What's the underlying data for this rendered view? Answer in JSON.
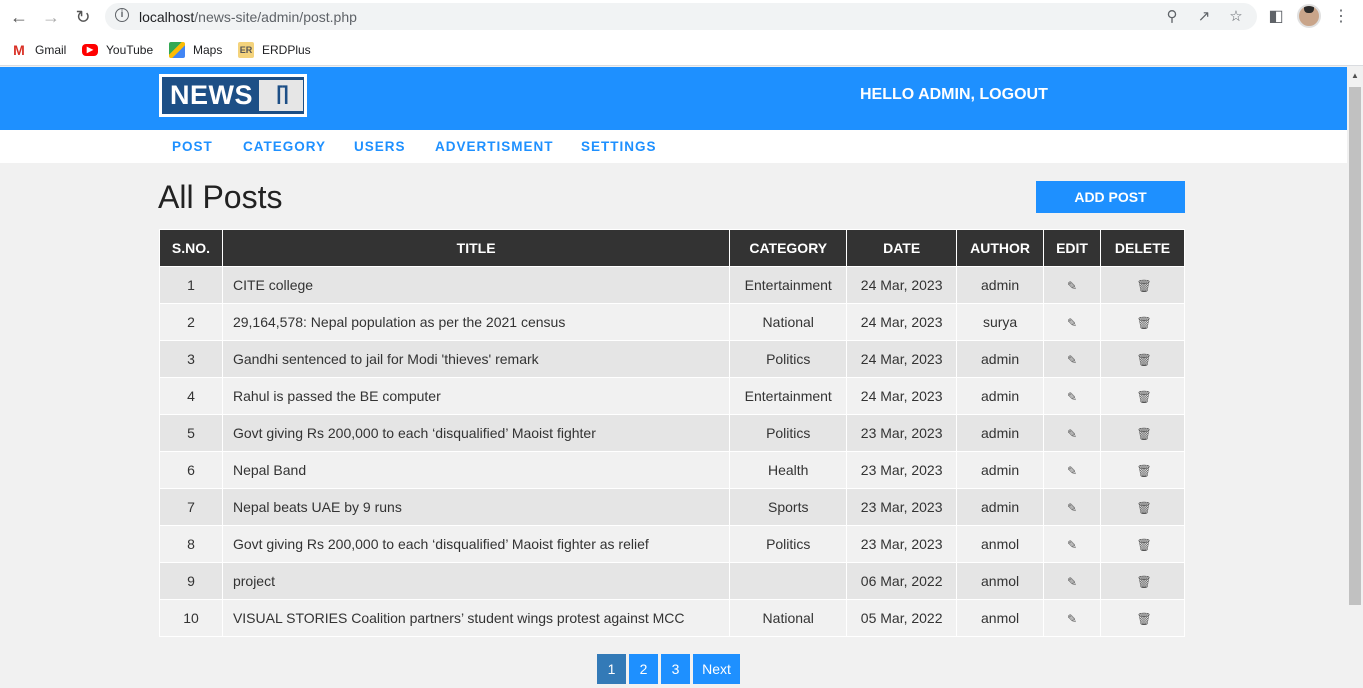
{
  "browser": {
    "url_host": "localhost",
    "url_path": "/news-site/admin/post.php",
    "bookmarks": [
      {
        "label": "Gmail",
        "icon": "gmail-icon"
      },
      {
        "label": "YouTube",
        "icon": "youtube-icon"
      },
      {
        "label": "Maps",
        "icon": "maps-icon"
      },
      {
        "label": "ERDPlus",
        "icon": "erdplus-icon"
      }
    ]
  },
  "header": {
    "logo_text": "NEWS",
    "greeting": "HELLO ADMIN, LOGOUT"
  },
  "menu": [
    "POST",
    "CATEGORY",
    "USERS",
    "ADVERTISMENT",
    "SETTINGS"
  ],
  "main": {
    "title": "All Posts",
    "add_button": "ADD POST"
  },
  "table": {
    "headers": [
      "S.NO.",
      "TITLE",
      "CATEGORY",
      "DATE",
      "AUTHOR",
      "EDIT",
      "DELETE"
    ],
    "rows": [
      {
        "sno": "1",
        "title": "CITE college",
        "category": "Entertainment",
        "date": "24 Mar, 2023",
        "author": "admin"
      },
      {
        "sno": "2",
        "title": "29,164,578: Nepal population as per the 2021 census",
        "category": "National",
        "date": "24 Mar, 2023",
        "author": "surya"
      },
      {
        "sno": "3",
        "title": "Gandhi sentenced to jail for Modi 'thieves' remark",
        "category": "Politics",
        "date": "24 Mar, 2023",
        "author": "admin"
      },
      {
        "sno": "4",
        "title": "Rahul is passed the BE computer",
        "category": "Entertainment",
        "date": "24 Mar, 2023",
        "author": "admin"
      },
      {
        "sno": "5",
        "title": "Govt giving Rs 200,000 to each ‘disqualified’ Maoist fighter",
        "category": "Politics",
        "date": "23 Mar, 2023",
        "author": "admin"
      },
      {
        "sno": "6",
        "title": "Nepal Band",
        "category": "Health",
        "date": "23 Mar, 2023",
        "author": "admin"
      },
      {
        "sno": "7",
        "title": "Nepal beats UAE by 9 runs",
        "category": "Sports",
        "date": "23 Mar, 2023",
        "author": "admin"
      },
      {
        "sno": "8",
        "title": "Govt giving Rs 200,000 to each ‘disqualified’ Maoist fighter as relief",
        "category": "Politics",
        "date": "23 Mar, 2023",
        "author": "anmol"
      },
      {
        "sno": "9",
        "title": "project",
        "category": "",
        "date": "06 Mar, 2022",
        "author": "anmol"
      },
      {
        "sno": "10",
        "title": "VISUAL STORIES Coalition partners’ student wings protest against MCC",
        "category": "National",
        "date": "05 Mar, 2022",
        "author": "anmol"
      }
    ]
  },
  "pagination": {
    "pages": [
      "1",
      "2",
      "3"
    ],
    "active": "1",
    "next": "Next"
  },
  "colors": {
    "brand_blue": "#1e90ff",
    "table_header": "#333333",
    "active_page": "#337ab7"
  }
}
